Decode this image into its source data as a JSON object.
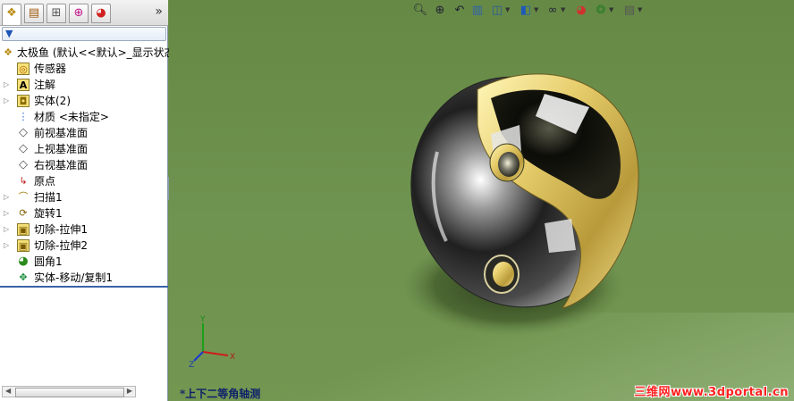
{
  "panel": {
    "tabs": [
      {
        "name": "feature-manager-tab",
        "icon": "tree-icon"
      },
      {
        "name": "property-manager-tab",
        "icon": "property-icon"
      },
      {
        "name": "configuration-manager-tab",
        "icon": "config-icon"
      },
      {
        "name": "dimxpert-tab",
        "icon": "target-icon"
      },
      {
        "name": "display-manager-tab",
        "icon": "color-wheel-icon"
      }
    ],
    "more_label": "»",
    "filter_icon": "filter-icon"
  },
  "tree": {
    "root": "太极鱼 (默认<<默认>_显示状态",
    "items": [
      {
        "label": "传感器",
        "icon": "sensor-icon",
        "expandable": false
      },
      {
        "label": "注解",
        "icon": "annotation-icon",
        "expandable": true
      },
      {
        "label": "实体(2)",
        "icon": "solid-bodies-icon",
        "expandable": true
      },
      {
        "label": "材质 <未指定>",
        "icon": "material-icon",
        "expandable": false
      },
      {
        "label": "前视基准面",
        "icon": "plane-icon",
        "expandable": false
      },
      {
        "label": "上视基准面",
        "icon": "plane-icon",
        "expandable": false
      },
      {
        "label": "右视基准面",
        "icon": "plane-icon",
        "expandable": false
      },
      {
        "label": "原点",
        "icon": "origin-icon",
        "expandable": false
      },
      {
        "label": "扫描1",
        "icon": "sweep-icon",
        "expandable": true
      },
      {
        "label": "旋转1",
        "icon": "revolve-icon",
        "expandable": true
      },
      {
        "label": "切除-拉伸1",
        "icon": "cut-extrude-icon",
        "expandable": true
      },
      {
        "label": "切除-拉伸2",
        "icon": "cut-extrude-icon",
        "expandable": true
      },
      {
        "label": "圆角1",
        "icon": "fillet-icon",
        "expandable": false
      },
      {
        "label": "实体-移动/复制1",
        "icon": "move-copy-icon",
        "expandable": false
      }
    ]
  },
  "viewport": {
    "view_name": "*上下二等角轴测",
    "watermark": "三维网www.3dportal.cn",
    "toolbar": [
      {
        "name": "zoom-to-fit-button",
        "icon": "zoom-fit-icon",
        "dropdown": false
      },
      {
        "name": "zoom-to-area-button",
        "icon": "zoom-area-icon",
        "dropdown": false
      },
      {
        "name": "previous-view-button",
        "icon": "previous-view-icon",
        "dropdown": false
      },
      {
        "name": "section-view-button",
        "icon": "section-view-icon",
        "dropdown": false
      },
      {
        "name": "view-orientation-button",
        "icon": "view-orientation-icon",
        "dropdown": true
      },
      {
        "name": "display-style-button",
        "icon": "display-style-icon",
        "dropdown": true
      },
      {
        "name": "hide-show-items-button",
        "icon": "hide-show-icon",
        "dropdown": true
      },
      {
        "name": "edit-appearance-button",
        "icon": "appearance-icon",
        "dropdown": false
      },
      {
        "name": "apply-scene-button",
        "icon": "scene-icon",
        "dropdown": true
      },
      {
        "name": "view-settings-button",
        "icon": "view-settings-icon",
        "dropdown": true
      }
    ],
    "triad_axes": {
      "x": "X",
      "y": "Y",
      "z": "Z"
    }
  },
  "colors": {
    "background": "#6b8f4c",
    "view_name": "#0d1f6b",
    "watermark": "#ff2020",
    "gold": "#e8d27a",
    "chrome": "#2a2a2a"
  }
}
